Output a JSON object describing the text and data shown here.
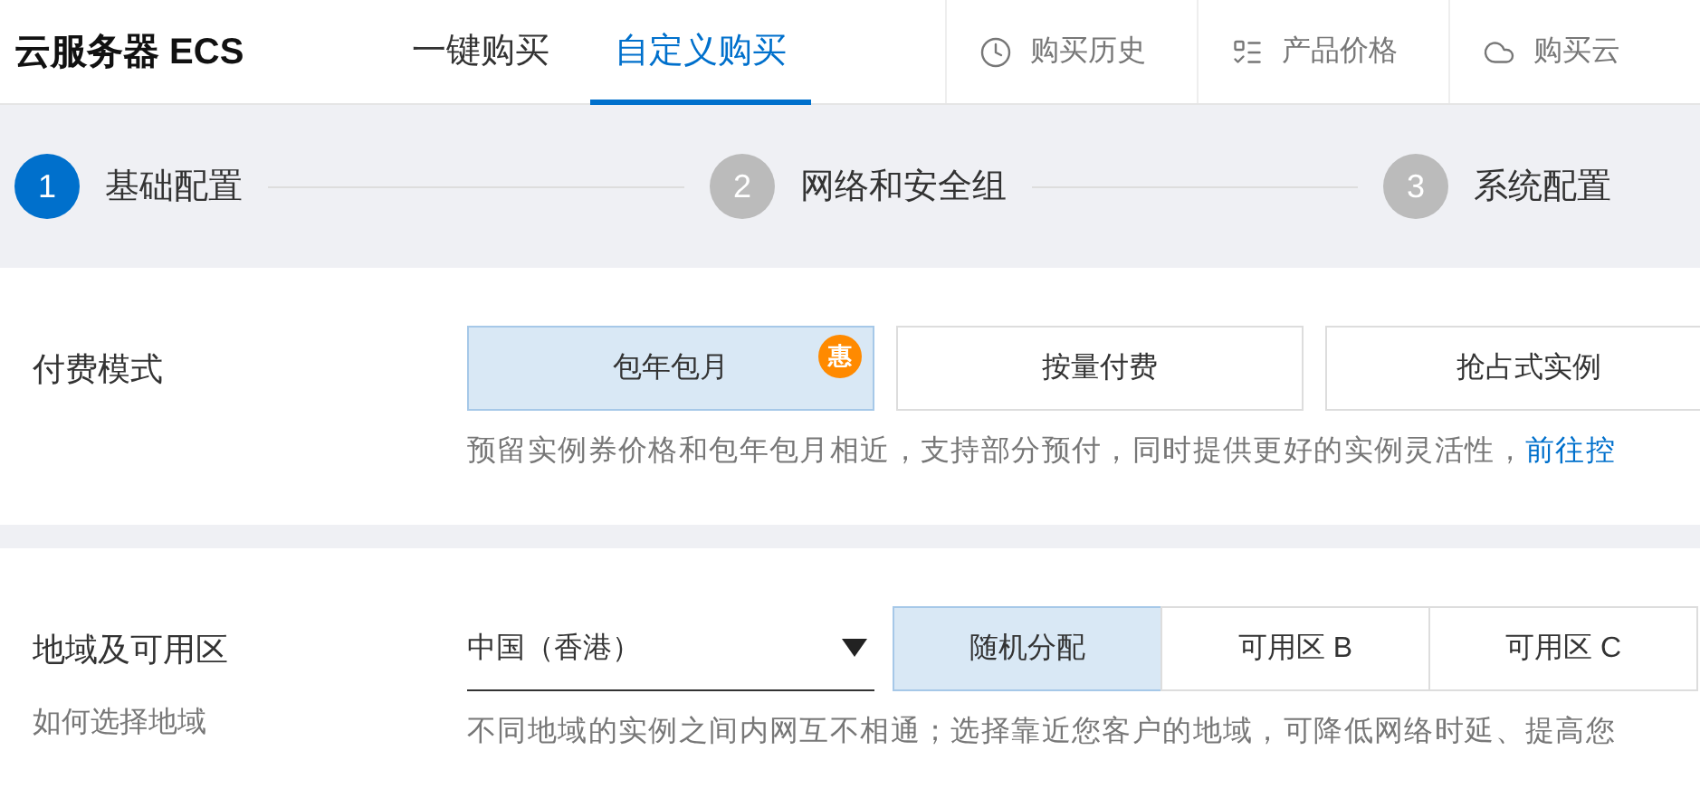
{
  "header": {
    "title": "云服务器 ECS",
    "tabs": [
      {
        "label": "一键购买",
        "selected": false
      },
      {
        "label": "自定义购买",
        "selected": true
      }
    ],
    "links": [
      "购买历史",
      "产品价格",
      "购买云"
    ]
  },
  "steps": [
    {
      "number": "1",
      "label": "基础配置",
      "selected": true
    },
    {
      "number": "2",
      "label": "网络和安全组",
      "selected": false
    },
    {
      "number": "3",
      "label": "系统配置",
      "selected": false
    }
  ],
  "billing": {
    "label": "付费模式",
    "options": [
      {
        "label": "包年包月",
        "selected": true,
        "badge": "惠"
      },
      {
        "label": "按量付费",
        "selected": false
      },
      {
        "label": "抢占式实例",
        "selected": false
      }
    ],
    "description": "预留实例券价格和包年包月相近，支持部分预付，同时提供更好的实例灵活性，",
    "link": "前往控"
  },
  "region": {
    "label": "地域及可用区",
    "help_link": "如何选择地域",
    "select": "中国（香港）",
    "zones": [
      {
        "label": "随机分配",
        "selected": true
      },
      {
        "label": "可用区 B",
        "selected": false
      },
      {
        "label": "可用区 C",
        "selected": false
      }
    ],
    "description": "不同地域的实例之间内网互不相通；选择靠近您客户的地域，可降低网络时延、提高您"
  }
}
